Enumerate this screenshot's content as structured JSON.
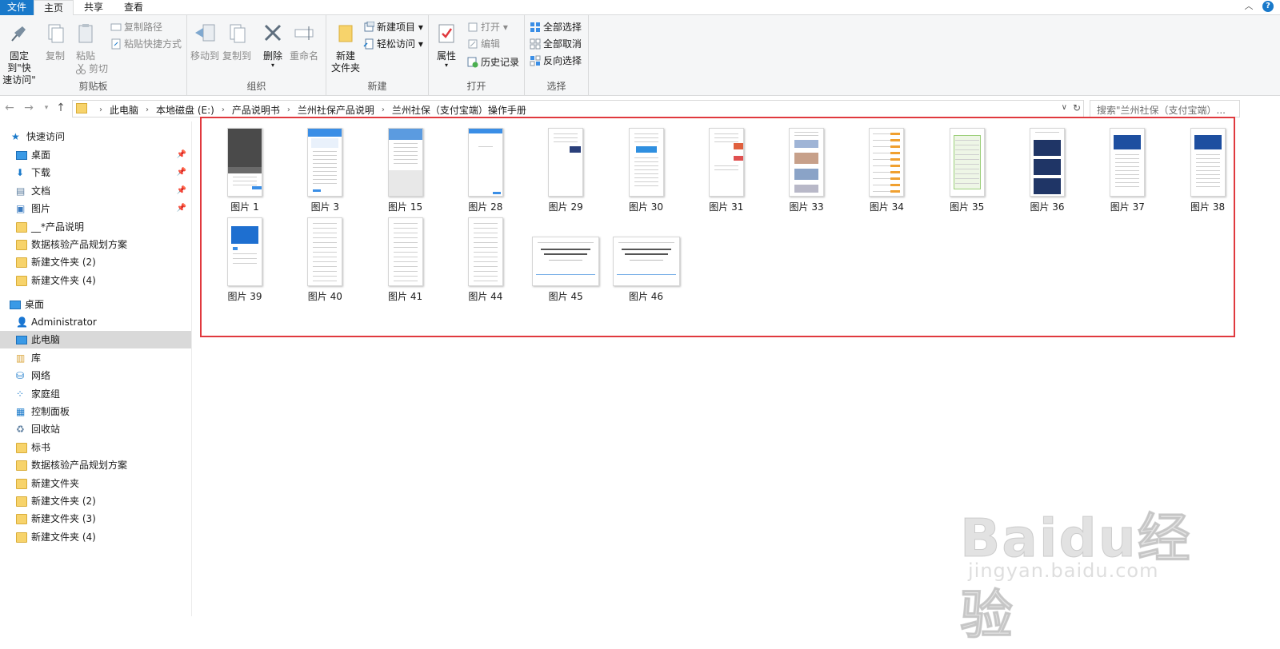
{
  "tabs": {
    "file": "文件",
    "home": "主页",
    "share": "共享",
    "view": "查看",
    "help": "?"
  },
  "ribbon": {
    "clipboard": {
      "pin": "固定到\"快\n速访问\"",
      "pin_line1": "固定到\"快",
      "pin_line2": "速访问\"",
      "copy": "复制",
      "paste": "粘贴",
      "copy_path": "复制路径",
      "paste_shortcut": "粘贴快捷方式",
      "cut": "剪切",
      "title": "剪贴板"
    },
    "organize": {
      "move_to": "移动到",
      "copy_to": "复制到",
      "delete": "删除",
      "rename": "重命名",
      "title": "组织"
    },
    "new": {
      "new_folder_line1": "新建",
      "new_folder_line2": "文件夹",
      "new_item": "新建项目",
      "easy_access": "轻松访问",
      "title": "新建"
    },
    "open": {
      "properties": "属性",
      "open": "打开",
      "edit": "编辑",
      "history": "历史记录",
      "title": "打开"
    },
    "select": {
      "select_all": "全部选择",
      "select_none": "全部取消",
      "invert": "反向选择",
      "title": "选择"
    }
  },
  "address": {
    "crumbs": [
      "此电脑",
      "本地磁盘 (E:)",
      "产品说明书",
      "兰州社保产品说明",
      "兰州社保（支付宝端）操作手册"
    ],
    "search_placeholder": "搜索\"兰州社保（支付宝端）...",
    "refresh": "↻"
  },
  "sidebar": {
    "quick_access": "快速访问",
    "quick_items": [
      "桌面",
      "下载",
      "文档",
      "图片",
      "__*产品说明",
      "数据核验产品规划方案",
      "新建文件夹 (2)",
      "新建文件夹 (4)"
    ],
    "desktop": "桌面",
    "desktop_items": [
      "Administrator",
      "此电脑",
      "库",
      "网络",
      "家庭组",
      "控制面板",
      "回收站",
      "标书",
      "数据核验产品规划方案",
      "新建文件夹",
      "新建文件夹 (2)",
      "新建文件夹 (3)",
      "新建文件夹 (4)"
    ]
  },
  "files": [
    {
      "name": "图片 1",
      "style": "dark"
    },
    {
      "name": "图片 3",
      "style": "blue-top"
    },
    {
      "name": "图片 15",
      "style": "blue-banner"
    },
    {
      "name": "图片 28",
      "style": "blue-top-plain"
    },
    {
      "name": "图片 29",
      "style": "doc-img"
    },
    {
      "name": "图片 30",
      "style": "doc-blue"
    },
    {
      "name": "图片 31",
      "style": "doc-red"
    },
    {
      "name": "图片 33",
      "style": "photos"
    },
    {
      "name": "图片 34",
      "style": "orange-list"
    },
    {
      "name": "图片 35",
      "style": "green-doc"
    },
    {
      "name": "图片 36",
      "style": "dark-blocks"
    },
    {
      "name": "图片 37",
      "style": "blue-header-list"
    },
    {
      "name": "图片 38",
      "style": "blue-header-list"
    },
    {
      "name": "图片 39",
      "style": "blue-header-app"
    },
    {
      "name": "图片 40",
      "style": "list"
    },
    {
      "name": "图片 41",
      "style": "list"
    },
    {
      "name": "图片 44",
      "style": "list"
    },
    {
      "name": "图片 45",
      "style": "landscape"
    },
    {
      "name": "图片 46",
      "style": "landscape"
    }
  ],
  "watermark": {
    "logo": "Baidu经验",
    "url": "jingyan.baidu.com"
  }
}
